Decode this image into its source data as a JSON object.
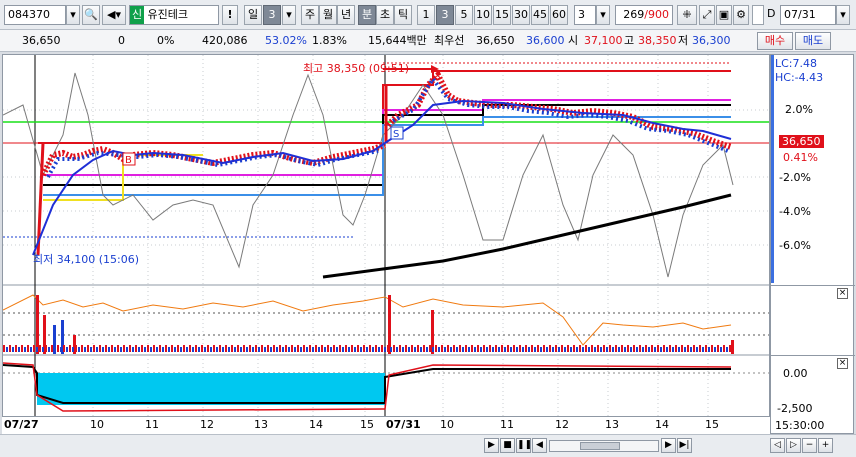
{
  "toolbar": {
    "stock_code": "084370",
    "market_badge": "신",
    "stock_name": "유진테크",
    "alert": "!",
    "period_sel": "일",
    "period_num": "3",
    "periods": [
      "주",
      "월",
      "년",
      "분",
      "초",
      "틱"
    ],
    "active_period": "분",
    "minutes": [
      "1",
      "3",
      "5",
      "10",
      "15",
      "30",
      "45",
      "60"
    ],
    "active_minute": "3",
    "interval_value": "3",
    "count_value": "269",
    "count_total": "/900",
    "date_checkbox_label": "D",
    "date_value": "07/31"
  },
  "info": {
    "price": "36,650",
    "change": "0",
    "change_pct": "0%",
    "volume": "420,086",
    "vol_ratio": "53.02%",
    "turnover": "1.83%",
    "amount": "15,644백만",
    "best_label": "최우선",
    "best_ask": "36,650",
    "best_bid": "36,600",
    "open_label": "시",
    "open": "37,100",
    "high_label": "고",
    "high": "38,350",
    "low_label": "저",
    "low": "36,300",
    "buy_label": "매수",
    "sell_label": "매도"
  },
  "chart": {
    "high_note": "최고 38,350 (09:51)",
    "low_note": "최저 34,100 (15:06)",
    "marker_b": "B",
    "marker_s": "S",
    "colors": {
      "up": "#e0101a",
      "down": "#1a3fd0",
      "ma_blue": "#1f2fd6",
      "ma_magenta": "#e020e0",
      "ma_yellow": "#f0e020",
      "green_line": "#18e018",
      "volume_fill": "#00c8f0",
      "long_ma": "#000000"
    }
  },
  "axis": {
    "lc": "LC:7.48",
    "hc": "HC:-4.43",
    "pct_labels": [
      "2.0%",
      "-2.0%",
      "-4.0%",
      "-6.0%"
    ],
    "current_price": "36,650",
    "current_pct": "0.41%",
    "osc_labels": [
      "0.00",
      "-2,500"
    ]
  },
  "xaxis": {
    "labels": [
      "07/27",
      "10",
      "11",
      "12",
      "13",
      "14",
      "15",
      "07/31",
      "10",
      "11",
      "12",
      "13",
      "14",
      "15"
    ],
    "time_label": "15:30:00"
  }
}
